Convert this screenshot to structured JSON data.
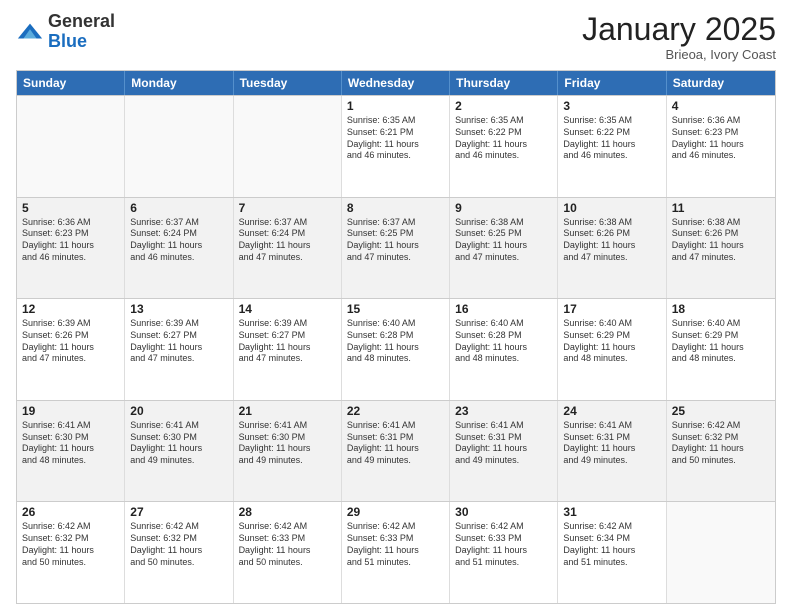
{
  "logo": {
    "general": "General",
    "blue": "Blue"
  },
  "header": {
    "month": "January 2025",
    "location": "Brieoa, Ivory Coast"
  },
  "days_of_week": [
    "Sunday",
    "Monday",
    "Tuesday",
    "Wednesday",
    "Thursday",
    "Friday",
    "Saturday"
  ],
  "weeks": [
    [
      {
        "day": "",
        "info": "",
        "empty": true
      },
      {
        "day": "",
        "info": "",
        "empty": true
      },
      {
        "day": "",
        "info": "",
        "empty": true
      },
      {
        "day": "1",
        "info": "Sunrise: 6:35 AM\nSunset: 6:21 PM\nDaylight: 11 hours\nand 46 minutes."
      },
      {
        "day": "2",
        "info": "Sunrise: 6:35 AM\nSunset: 6:22 PM\nDaylight: 11 hours\nand 46 minutes."
      },
      {
        "day": "3",
        "info": "Sunrise: 6:35 AM\nSunset: 6:22 PM\nDaylight: 11 hours\nand 46 minutes."
      },
      {
        "day": "4",
        "info": "Sunrise: 6:36 AM\nSunset: 6:23 PM\nDaylight: 11 hours\nand 46 minutes."
      }
    ],
    [
      {
        "day": "5",
        "info": "Sunrise: 6:36 AM\nSunset: 6:23 PM\nDaylight: 11 hours\nand 46 minutes."
      },
      {
        "day": "6",
        "info": "Sunrise: 6:37 AM\nSunset: 6:24 PM\nDaylight: 11 hours\nand 46 minutes."
      },
      {
        "day": "7",
        "info": "Sunrise: 6:37 AM\nSunset: 6:24 PM\nDaylight: 11 hours\nand 47 minutes."
      },
      {
        "day": "8",
        "info": "Sunrise: 6:37 AM\nSunset: 6:25 PM\nDaylight: 11 hours\nand 47 minutes."
      },
      {
        "day": "9",
        "info": "Sunrise: 6:38 AM\nSunset: 6:25 PM\nDaylight: 11 hours\nand 47 minutes."
      },
      {
        "day": "10",
        "info": "Sunrise: 6:38 AM\nSunset: 6:26 PM\nDaylight: 11 hours\nand 47 minutes."
      },
      {
        "day": "11",
        "info": "Sunrise: 6:38 AM\nSunset: 6:26 PM\nDaylight: 11 hours\nand 47 minutes."
      }
    ],
    [
      {
        "day": "12",
        "info": "Sunrise: 6:39 AM\nSunset: 6:26 PM\nDaylight: 11 hours\nand 47 minutes."
      },
      {
        "day": "13",
        "info": "Sunrise: 6:39 AM\nSunset: 6:27 PM\nDaylight: 11 hours\nand 47 minutes."
      },
      {
        "day": "14",
        "info": "Sunrise: 6:39 AM\nSunset: 6:27 PM\nDaylight: 11 hours\nand 47 minutes."
      },
      {
        "day": "15",
        "info": "Sunrise: 6:40 AM\nSunset: 6:28 PM\nDaylight: 11 hours\nand 48 minutes."
      },
      {
        "day": "16",
        "info": "Sunrise: 6:40 AM\nSunset: 6:28 PM\nDaylight: 11 hours\nand 48 minutes."
      },
      {
        "day": "17",
        "info": "Sunrise: 6:40 AM\nSunset: 6:29 PM\nDaylight: 11 hours\nand 48 minutes."
      },
      {
        "day": "18",
        "info": "Sunrise: 6:40 AM\nSunset: 6:29 PM\nDaylight: 11 hours\nand 48 minutes."
      }
    ],
    [
      {
        "day": "19",
        "info": "Sunrise: 6:41 AM\nSunset: 6:30 PM\nDaylight: 11 hours\nand 48 minutes."
      },
      {
        "day": "20",
        "info": "Sunrise: 6:41 AM\nSunset: 6:30 PM\nDaylight: 11 hours\nand 49 minutes."
      },
      {
        "day": "21",
        "info": "Sunrise: 6:41 AM\nSunset: 6:30 PM\nDaylight: 11 hours\nand 49 minutes."
      },
      {
        "day": "22",
        "info": "Sunrise: 6:41 AM\nSunset: 6:31 PM\nDaylight: 11 hours\nand 49 minutes."
      },
      {
        "day": "23",
        "info": "Sunrise: 6:41 AM\nSunset: 6:31 PM\nDaylight: 11 hours\nand 49 minutes."
      },
      {
        "day": "24",
        "info": "Sunrise: 6:41 AM\nSunset: 6:31 PM\nDaylight: 11 hours\nand 49 minutes."
      },
      {
        "day": "25",
        "info": "Sunrise: 6:42 AM\nSunset: 6:32 PM\nDaylight: 11 hours\nand 50 minutes."
      }
    ],
    [
      {
        "day": "26",
        "info": "Sunrise: 6:42 AM\nSunset: 6:32 PM\nDaylight: 11 hours\nand 50 minutes."
      },
      {
        "day": "27",
        "info": "Sunrise: 6:42 AM\nSunset: 6:32 PM\nDaylight: 11 hours\nand 50 minutes."
      },
      {
        "day": "28",
        "info": "Sunrise: 6:42 AM\nSunset: 6:33 PM\nDaylight: 11 hours\nand 50 minutes."
      },
      {
        "day": "29",
        "info": "Sunrise: 6:42 AM\nSunset: 6:33 PM\nDaylight: 11 hours\nand 51 minutes."
      },
      {
        "day": "30",
        "info": "Sunrise: 6:42 AM\nSunset: 6:33 PM\nDaylight: 11 hours\nand 51 minutes."
      },
      {
        "day": "31",
        "info": "Sunrise: 6:42 AM\nSunset: 6:34 PM\nDaylight: 11 hours\nand 51 minutes."
      },
      {
        "day": "",
        "info": "",
        "empty": true
      }
    ]
  ]
}
